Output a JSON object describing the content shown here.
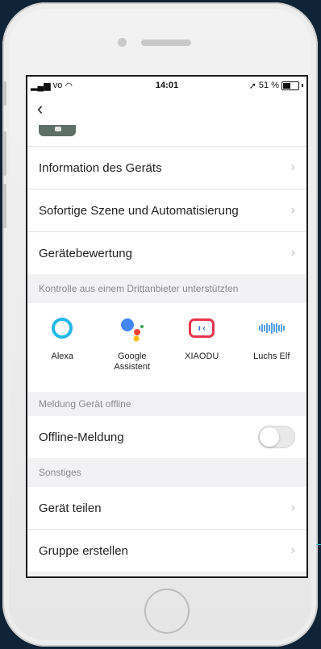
{
  "status_bar": {
    "carrier": "vo",
    "time": "14:01",
    "battery_percent": "51 %"
  },
  "nav": {
    "back_icon": "chevron-left-icon"
  },
  "menu_items": [
    {
      "label": "Information des Geräts"
    },
    {
      "label": "Sofortige Szene und Automatisierung"
    },
    {
      "label": "Gerätebewertung"
    }
  ],
  "third_party": {
    "header": "Kontrolle aus einem Drittanbieter unterstützten",
    "assistants": [
      {
        "label": "Alexa",
        "icon": "alexa-icon",
        "color": "#24b8e8"
      },
      {
        "label": "Google\nAssistent",
        "icon": "google-assistant-icon"
      },
      {
        "label": "XIAODU",
        "icon": "xiaodu-icon",
        "color": "#e8364d"
      },
      {
        "label": "Luchs Elf",
        "icon": "luchs-elf-icon",
        "color": "#5aa0e6"
      }
    ]
  },
  "offline": {
    "header": "Meldung Gerät offline",
    "label": "Offline-Meldung",
    "toggle_on": false
  },
  "misc": {
    "header": "Sonstiges",
    "items": [
      {
        "label": "Gerät teilen"
      },
      {
        "label": "Gruppe erstellen"
      }
    ]
  }
}
